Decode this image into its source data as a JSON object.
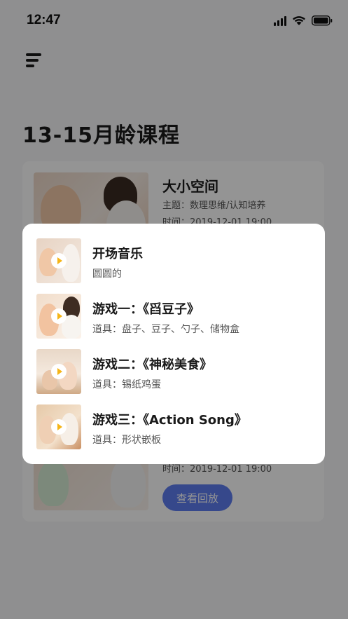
{
  "status_bar": {
    "time": "12:47"
  },
  "page": {
    "title": "13-15月龄课程"
  },
  "course": {
    "title": "大小空间",
    "topic": "主题：数理思维/认知培养",
    "time": "时间：2019-12-01    19:00",
    "time_2": "时间：2019-12-01    19:00",
    "replay_label": "查看回放"
  },
  "popup": {
    "items": [
      {
        "title": "开场音乐",
        "sub": "圆圆的"
      },
      {
        "title": "游戏一：《舀豆子》",
        "sub": "道具：盘子、豆子、勺子、储物盒"
      },
      {
        "title": "游戏二：《神秘美食》",
        "sub": "道具：锡纸鸡蛋"
      },
      {
        "title": "游戏三：《Action Song》",
        "sub": "道具：形状嵌板"
      }
    ]
  },
  "colors": {
    "accent": "#5d7df0",
    "play": "#f5b518"
  }
}
